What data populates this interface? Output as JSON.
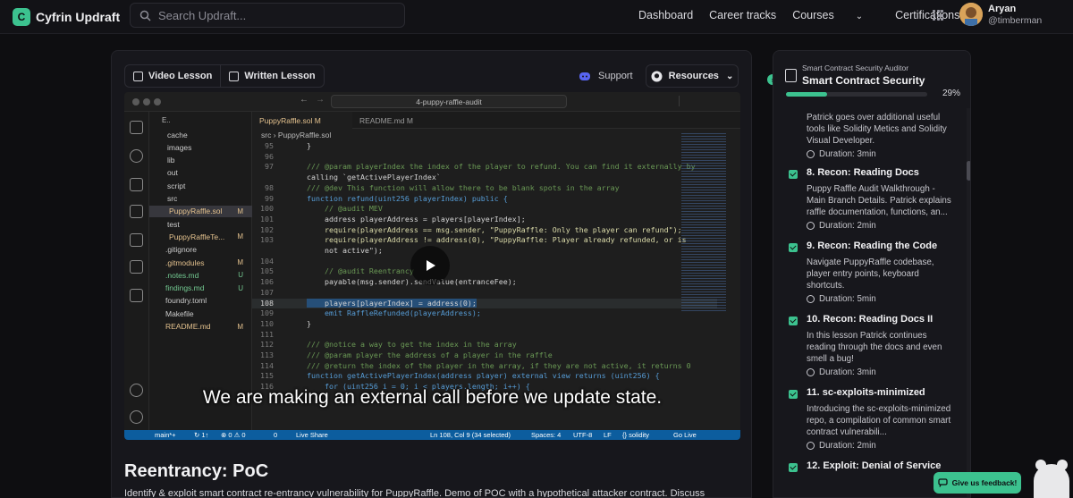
{
  "nav": {
    "brand": "Cyfrin Updraft",
    "search_placeholder": "Search Updraft...",
    "links": [
      "Dashboard",
      "Career tracks",
      "Courses",
      "Certifications"
    ],
    "user_name": "Aryan",
    "user_handle": "@timberman"
  },
  "lesson_tabs": {
    "video": "Video Lesson",
    "written": "Written Lesson"
  },
  "support_label": "Support",
  "resources_label": "Resources",
  "vscode": {
    "search": "4-puppy-raffle-audit",
    "explorer_header": "E..",
    "files": [
      {
        "name": "cache",
        "status": ""
      },
      {
        "name": "images",
        "status": ""
      },
      {
        "name": "lib",
        "status": ""
      },
      {
        "name": "out",
        "status": ""
      },
      {
        "name": "script",
        "status": ""
      },
      {
        "name": "src",
        "status": ""
      },
      {
        "name": "PuppyRaffle.sol",
        "status": "M"
      },
      {
        "name": "test",
        "status": ""
      },
      {
        "name": "PuppyRaffleTe...",
        "status": "M"
      },
      {
        "name": ".gitignore",
        "status": ""
      },
      {
        "name": ".gitmodules",
        "status": "M"
      },
      {
        "name": ".notes.md",
        "status": "U"
      },
      {
        "name": "findings.md",
        "status": "U"
      },
      {
        "name": "foundry.toml",
        "status": ""
      },
      {
        "name": "Makefile",
        "status": ""
      },
      {
        "name": "README.md",
        "status": "M"
      }
    ],
    "tabs": [
      "PuppyRaffle.sol M",
      "README.md M"
    ],
    "breadcrumb": "src  ›  PuppyRaffle.sol",
    "lines": [
      {
        "no": "95",
        "code": "}"
      },
      {
        "no": "96",
        "code": ""
      },
      {
        "no": "97",
        "code": "/// @param playerIndex the index of the player to refund. You can find it externally by"
      },
      {
        "no": "",
        "code": "calling `getActivePlayerIndex`"
      },
      {
        "no": "98",
        "code": "/// @dev This function will allow there to be blank spots in the array"
      },
      {
        "no": "99",
        "code": "function refund(uint256 playerIndex) public {"
      },
      {
        "no": "100",
        "code": "    // @audit MEV"
      },
      {
        "no": "101",
        "code": "    address playerAddress = players[playerIndex];"
      },
      {
        "no": "102",
        "code": "    require(playerAddress == msg.sender, \"PuppyRaffle: Only the player can refund\");"
      },
      {
        "no": "103",
        "code": "    require(playerAddress != address(0), \"PuppyRaffle: Player already refunded, or is"
      },
      {
        "no": "",
        "code": "    not active\");"
      },
      {
        "no": "104",
        "code": ""
      },
      {
        "no": "105",
        "code": "    // @audit Reentrancy"
      },
      {
        "no": "106",
        "code": "    payable(msg.sender).sendValue(entranceFee);"
      },
      {
        "no": "107",
        "code": ""
      },
      {
        "no": "108",
        "code": "    players[playerIndex] = address(0);"
      },
      {
        "no": "109",
        "code": "    emit RaffleRefunded(playerAddress);"
      },
      {
        "no": "110",
        "code": "}"
      },
      {
        "no": "111",
        "code": ""
      },
      {
        "no": "112",
        "code": "/// @notice a way to get the index in the array"
      },
      {
        "no": "113",
        "code": "/// @param player the address of a player in the raffle"
      },
      {
        "no": "114",
        "code": "/// @return the index of the player in the array, if they are not active, it returns 0"
      },
      {
        "no": "115",
        "code": "function getActivePlayerIndex(address player) external view returns (uint256) {"
      },
      {
        "no": "116",
        "code": "    for (uint256 i = 0; i < players.length; i++) {"
      }
    ],
    "caption": "We are making an external call before we update state.",
    "status": {
      "branch": "main*+",
      "sync": "↻ 1↑",
      "problems": "⊗ 0 ⚠ 0",
      "ports": "0",
      "live_share": "Live Share",
      "position": "Ln 108, Col 9 (34 selected)",
      "spaces": "Spaces: 4",
      "encoding": "UTF-8",
      "eol": "LF",
      "lang": "{} solidity",
      "golive": "Go Live"
    }
  },
  "lesson": {
    "title": "Reentrancy: PoC",
    "description": "Identify & exploit smart contract re-entrancy vulnerability for PuppyRaffle. Demo of POC with a hypothetical attacker contract. Discuss"
  },
  "course": {
    "label": "Smart Contract Security Auditor",
    "title": "Smart Contract Security",
    "progress_pct": "29%",
    "progress_value": 0.29,
    "intro_desc": "Patrick goes over additional useful tools like Solidity Metics and Solidity Visual Developer.",
    "intro_duration": "Duration: 3min",
    "items": [
      {
        "title": "8. Recon: Reading Docs",
        "desc": "Puppy Raffle Audit Walkthrough - Main Branch Details. Patrick explains raffle documentation, functions, an...",
        "duration": "Duration: 2min"
      },
      {
        "title": "9. Recon: Reading the Code",
        "desc": "Navigate PuppyRaffle codebase, player entry points, keyboard shortcuts.",
        "duration": "Duration: 5min"
      },
      {
        "title": "10. Recon: Reading Docs II",
        "desc": "In this lesson Patrick continues reading through the docs and even smell a bug!",
        "duration": "Duration: 3min"
      },
      {
        "title": "11. sc-exploits-minimized",
        "desc": "Introducing the sc-exploits-minimized repo, a compilation of common smart contract vulnerabili...",
        "duration": "Duration: 2min"
      },
      {
        "title": "12. Exploit: Denial of Service",
        "desc": "",
        "duration": ""
      }
    ]
  },
  "feedback_label": "Give us feedback!",
  "colors": {
    "accent": "#3cc28f",
    "statusbar": "#0c5d9e"
  }
}
